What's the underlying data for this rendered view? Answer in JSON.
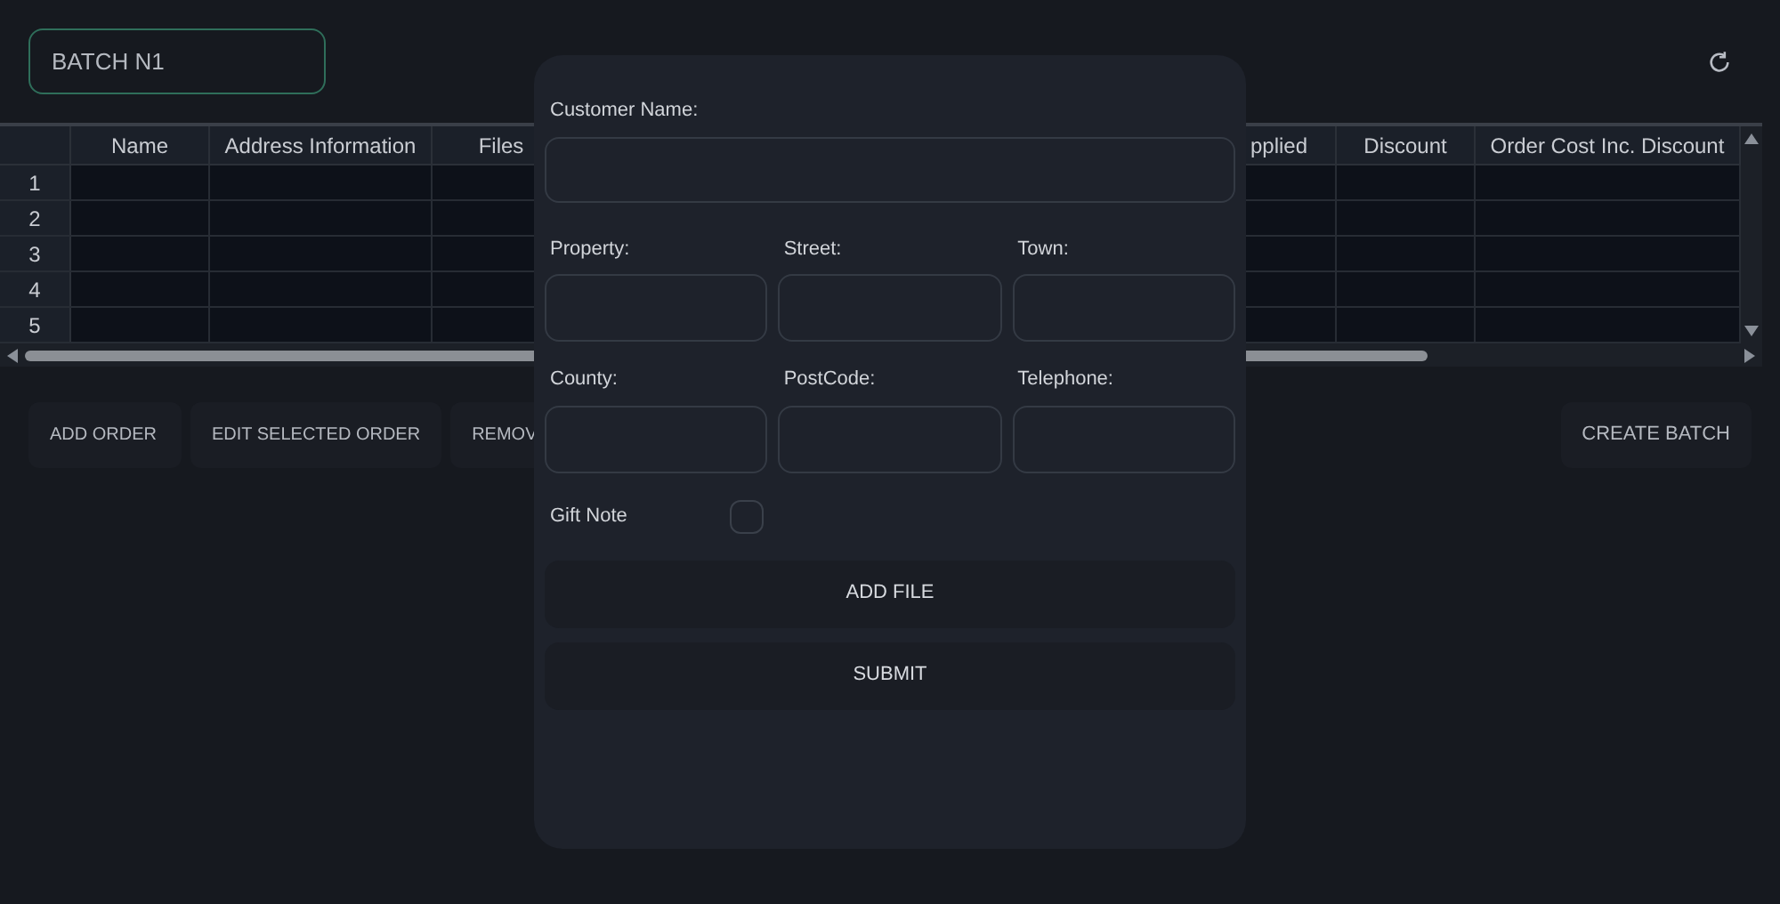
{
  "batch_field": {
    "value": "BATCH N1"
  },
  "table": {
    "columns": [
      {
        "label": "Name",
        "kind": "text"
      },
      {
        "label": "Address Information",
        "kind": "text"
      },
      {
        "label": "Files",
        "kind": "text"
      },
      {
        "kind": "hidden"
      },
      {
        "label": "pplied",
        "kind": "text"
      },
      {
        "label": "Discount",
        "kind": "text"
      },
      {
        "label": "Order Cost Inc. Discount",
        "kind": "text"
      }
    ],
    "rows": [
      {
        "number": "1"
      },
      {
        "number": "2"
      },
      {
        "number": "3"
      },
      {
        "number": "4"
      },
      {
        "number": "5"
      }
    ]
  },
  "actions": [
    {
      "label": "ADD ORDER"
    },
    {
      "label": "EDIT SELECTED ORDER"
    },
    {
      "label": "REMOV"
    }
  ],
  "create_button": {
    "label": "CREATE BATCH"
  },
  "dialog": {
    "customer_name": {
      "label": "Customer Name:"
    },
    "address_rows": [
      [
        {
          "label": "Property:"
        },
        {
          "label": "Street:"
        },
        {
          "label": "Town:"
        }
      ],
      [
        {
          "label": "County:"
        },
        {
          "label": "PostCode:"
        },
        {
          "label": "Telephone:"
        }
      ]
    ],
    "gift_note": {
      "label": "Gift Note",
      "checked": false
    },
    "buttons": [
      {
        "label": "ADD FILE"
      },
      {
        "label": "SUBMIT"
      }
    ]
  }
}
